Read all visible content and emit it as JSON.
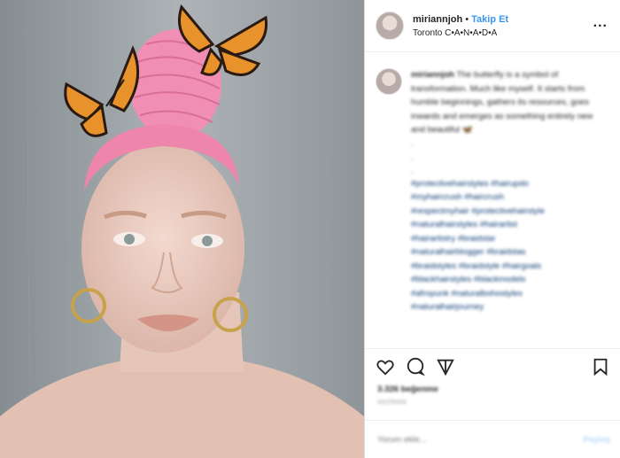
{
  "header": {
    "username": "miriannjoh",
    "separator": "•",
    "follow_label": "Takip Et",
    "location": "Toronto C•A•N•A•D•A",
    "more_label": "..."
  },
  "caption": {
    "username": "miriannjoh",
    "text": "The butterfly is a symbol of transformation. Much like myself. It starts from humble beginnings, gathers its resources, goes inwards and emerges as something entirely new and beautiful 🦋",
    "dots": [
      ".",
      ".",
      "."
    ],
    "hashtags": [
      "#protectivehairstyles #hairupdo",
      "#myhaircrush #haircrush",
      "#respectmyhair #protectivehairstyle",
      "#naturalhairstyles #hairartist",
      "#hairartistry #braidstar",
      "#naturalhairblogger #braidstas",
      "#braidstyles #braidstyle #hairgoals",
      "#blackhairstyles #blackmodels",
      "#afropunk #naturalbohostyles",
      "#naturalhairjourney"
    ]
  },
  "actions": {
    "likes": "3.326 beğenme",
    "time": "HAZİRAN"
  },
  "comment": {
    "placeholder": "Yorum ekle...",
    "post_label": "Paylaş"
  },
  "colors": {
    "accent": "#3897f0",
    "hair_pink": "#f08fb3",
    "butterfly_orange": "#e8922b"
  },
  "icons": [
    "heart-icon",
    "comment-icon",
    "share-icon",
    "bookmark-icon",
    "more-icon"
  ]
}
